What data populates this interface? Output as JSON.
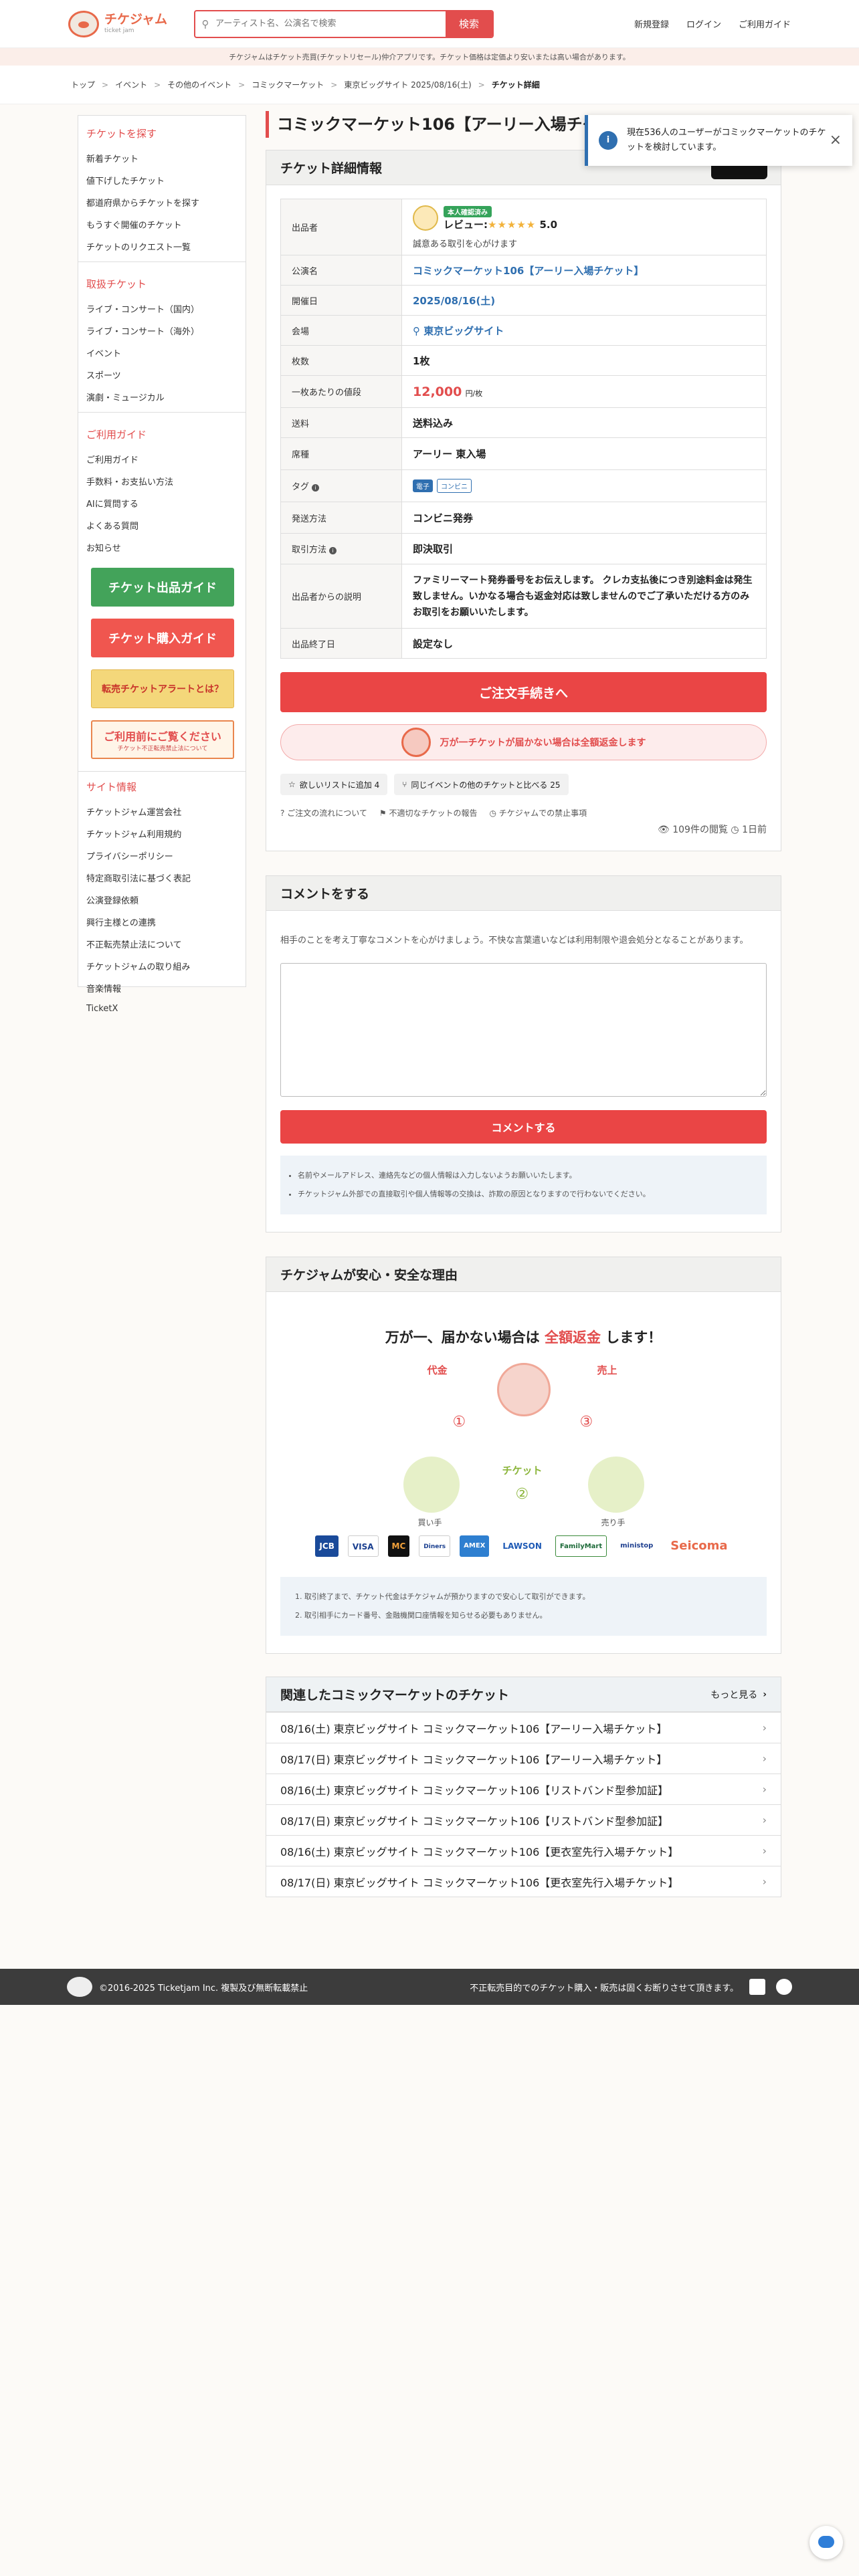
{
  "header": {
    "logo_text": "チケジャム",
    "logo_sub": "ticket jam",
    "search_placeholder": "アーティスト名、公演名で検索",
    "search_button": "検索",
    "nav": [
      "新規登録",
      "ログイン",
      "ご利用ガイド"
    ]
  },
  "notice": "チケジャムはチケット売買(チケットリセール)仲介アプリです。チケット価格は定価より安いまたは高い場合があります。",
  "breadcrumbs": [
    "トップ",
    "イベント",
    "その他のイベント",
    "コミックマーケット",
    "東京ビッグサイト 2025/08/16(土)",
    "チケット詳細"
  ],
  "sidebar": {
    "find_title": "チケットを探す",
    "find": [
      "新着チケット",
      "値下げしたチケット",
      "都道府県からチケットを探す",
      "もうすぐ開催のチケット",
      "チケットのリクエスト一覧"
    ],
    "genre_title": "取扱チケット",
    "genre": [
      "ライブ・コンサート（国内）",
      "ライブ・コンサート（海外）",
      "イベント",
      "スポーツ",
      "演劇・ミュージカル"
    ],
    "guide_title": "ご利用ガイド",
    "guide": [
      "ご利用ガイド",
      "手数料・お支払い方法",
      "AIに質問する",
      "よくある質問",
      "お知らせ"
    ],
    "banners": [
      "チケット出品ガイド",
      "チケット購入ガイド",
      "転売チケットアラートとは？",
      "ご利用前にご覧ください"
    ],
    "banner4_sub": "チケット不正転売禁止法について",
    "site_title": "サイト情報",
    "site": [
      "チケットジャム運営会社",
      "チケットジャム利用規約",
      "プライバシーポリシー",
      "特定商取引法に基づく表記",
      "公演登録依頼",
      "興行主様との連携",
      "不正転売禁止法について",
      "チケットジャムの取り組み",
      "音楽情報",
      "TicketX"
    ]
  },
  "page_title": "コミックマーケット106【アーリー入場チケット】 東京ビッグサイト",
  "toast": "現在536人のユーザーがコミックマーケットのチケットを検討しています。",
  "detail": {
    "heading": "チケット詳細情報",
    "rows": {
      "seller": "出品者",
      "event": "公演名",
      "date": "開催日",
      "venue": "会場",
      "qty": "枚数",
      "price": "一枚あたりの値段",
      "shipping": "送料",
      "seat": "席種",
      "tags": "タグ",
      "delivery": "発送方法",
      "method": "取引方法",
      "desc": "出品者からの説明",
      "end": "出品終了日"
    },
    "seller_badge": "本人確認済み",
    "seller_name": "レビュー:",
    "seller_rating": "5.0",
    "seller_msg": "誠意ある取引を心がけます",
    "event_value": "コミックマーケット106【アーリー入場チケット】",
    "date_value": "2025/08/16(土)",
    "venue_value": "東京ビッグサイト",
    "qty_value": "1枚",
    "price_value": "12,000",
    "price_unit": "円/枚",
    "shipping_value": "送料込み",
    "seat_value": "アーリー 東入場",
    "tag1": "電子",
    "tag2": "コンビニ",
    "delivery_value": "コンビニ発券",
    "method_value": "即決取引",
    "desc_value": "ファミリーマート発券番号をお伝えします。 クレカ支払後につき別途料金は発生致しません。いかなる場合も返金対応は致しませんのでご了承いただける方のみお取引をお願いいたします。",
    "end_value": "設定なし",
    "order_button": "ご注文手続きへ",
    "guarantee": "万が一チケットが届かない場合は全額返金します",
    "wish": "欲しいリストに追加 4",
    "compare": "同じイベントの他のチケットと比べる 25",
    "link1": "ご注文の流れについて",
    "link2": "不適切なチケットの報告",
    "link3": "チケジャムでの禁止事項",
    "views": "109件の閲覧",
    "ago": "1日前"
  },
  "comment": {
    "heading": "コメントをする",
    "note": "相手のことを考え丁寧なコメントを心がけましょう。不快な言葉遣いなどは利用制限や退会処分となることがあります。",
    "button": "コメントする",
    "info": [
      "名前やメールアドレス、連絡先などの個人情報は入力しないようお願いいたします。",
      "チケットジャム外部での直接取引や個人情報等の交換は、詐欺の原因となりますので行わないでください。"
    ]
  },
  "safety": {
    "heading": "チケジャムが安心・安全な理由",
    "sub_pre": "万が一、届かない場合は ",
    "sub_em": "全額返金",
    "sub_post": " します！",
    "flow_pay": "代金",
    "flow_sales": "売上",
    "flow_ticket": "チケット",
    "flow_buyer": "買い手",
    "flow_seller": "売り手",
    "pay": [
      "JCB",
      "VISA",
      "MC",
      "Diners",
      "AMEX",
      "LAWSON",
      "FamilyMart",
      "ministop",
      "Seicoma"
    ],
    "points": [
      "取引終了まで、チケット代金はチケジャムが預かりますので安心して取引ができます。",
      "取引相手にカード番号、金融機関口座情報を知らせる必要もありません。"
    ]
  },
  "related": {
    "heading": "関連したコミックマーケットのチケット",
    "more": "もっと見る",
    "items": [
      "08/16(土) 東京ビッグサイト コミックマーケット106【アーリー入場チケット】",
      "08/17(日) 東京ビッグサイト コミックマーケット106【アーリー入場チケット】",
      "08/16(土) 東京ビッグサイト コミックマーケット106【リストバンド型参加証】",
      "08/17(日) 東京ビッグサイト コミックマーケット106【リストバンド型参加証】",
      "08/16(土) 東京ビッグサイト コミックマーケット106【更衣室先行入場チケット】",
      "08/17(日) 東京ビッグサイト コミックマーケット106【更衣室先行入場チケット】"
    ]
  },
  "footer": {
    "copyright": "©2016-2025 Ticketjam Inc. 複製及び無断転載禁止",
    "right": "不正転売目的でのチケット購入・販売は固くお断りさせて頂きます。"
  }
}
